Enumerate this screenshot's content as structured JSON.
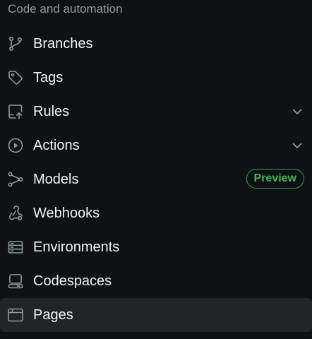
{
  "section": {
    "title": "Code and automation"
  },
  "nav": {
    "items": [
      {
        "label": "Branches",
        "icon": "git-branch-icon"
      },
      {
        "label": "Tags",
        "icon": "tag-icon"
      },
      {
        "label": "Rules",
        "icon": "repo-push-icon",
        "expandable": true
      },
      {
        "label": "Actions",
        "icon": "play-icon",
        "expandable": true
      },
      {
        "label": "Models",
        "icon": "models-icon",
        "badge": "Preview"
      },
      {
        "label": "Webhooks",
        "icon": "webhook-icon"
      },
      {
        "label": "Environments",
        "icon": "server-icon"
      },
      {
        "label": "Codespaces",
        "icon": "codespaces-icon"
      },
      {
        "label": "Pages",
        "icon": "browser-icon",
        "active": true
      }
    ]
  },
  "colors": {
    "background": "#0f1117",
    "active_background": "#20252c",
    "text": "#f0f3f6",
    "muted": "#9198a1",
    "badge": "#3fb950"
  }
}
